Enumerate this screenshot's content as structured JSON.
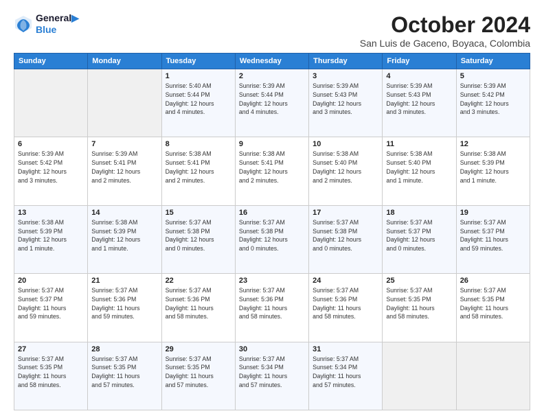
{
  "logo": {
    "line1": "General",
    "line2": "Blue"
  },
  "title": "October 2024",
  "location": "San Luis de Gaceno, Boyaca, Colombia",
  "days_of_week": [
    "Sunday",
    "Monday",
    "Tuesday",
    "Wednesday",
    "Thursday",
    "Friday",
    "Saturday"
  ],
  "weeks": [
    [
      {
        "day": "",
        "info": ""
      },
      {
        "day": "",
        "info": ""
      },
      {
        "day": "1",
        "info": "Sunrise: 5:40 AM\nSunset: 5:44 PM\nDaylight: 12 hours\nand 4 minutes."
      },
      {
        "day": "2",
        "info": "Sunrise: 5:39 AM\nSunset: 5:44 PM\nDaylight: 12 hours\nand 4 minutes."
      },
      {
        "day": "3",
        "info": "Sunrise: 5:39 AM\nSunset: 5:43 PM\nDaylight: 12 hours\nand 3 minutes."
      },
      {
        "day": "4",
        "info": "Sunrise: 5:39 AM\nSunset: 5:43 PM\nDaylight: 12 hours\nand 3 minutes."
      },
      {
        "day": "5",
        "info": "Sunrise: 5:39 AM\nSunset: 5:42 PM\nDaylight: 12 hours\nand 3 minutes."
      }
    ],
    [
      {
        "day": "6",
        "info": "Sunrise: 5:39 AM\nSunset: 5:42 PM\nDaylight: 12 hours\nand 3 minutes."
      },
      {
        "day": "7",
        "info": "Sunrise: 5:39 AM\nSunset: 5:41 PM\nDaylight: 12 hours\nand 2 minutes."
      },
      {
        "day": "8",
        "info": "Sunrise: 5:38 AM\nSunset: 5:41 PM\nDaylight: 12 hours\nand 2 minutes."
      },
      {
        "day": "9",
        "info": "Sunrise: 5:38 AM\nSunset: 5:41 PM\nDaylight: 12 hours\nand 2 minutes."
      },
      {
        "day": "10",
        "info": "Sunrise: 5:38 AM\nSunset: 5:40 PM\nDaylight: 12 hours\nand 2 minutes."
      },
      {
        "day": "11",
        "info": "Sunrise: 5:38 AM\nSunset: 5:40 PM\nDaylight: 12 hours\nand 1 minute."
      },
      {
        "day": "12",
        "info": "Sunrise: 5:38 AM\nSunset: 5:39 PM\nDaylight: 12 hours\nand 1 minute."
      }
    ],
    [
      {
        "day": "13",
        "info": "Sunrise: 5:38 AM\nSunset: 5:39 PM\nDaylight: 12 hours\nand 1 minute."
      },
      {
        "day": "14",
        "info": "Sunrise: 5:38 AM\nSunset: 5:39 PM\nDaylight: 12 hours\nand 1 minute."
      },
      {
        "day": "15",
        "info": "Sunrise: 5:37 AM\nSunset: 5:38 PM\nDaylight: 12 hours\nand 0 minutes."
      },
      {
        "day": "16",
        "info": "Sunrise: 5:37 AM\nSunset: 5:38 PM\nDaylight: 12 hours\nand 0 minutes."
      },
      {
        "day": "17",
        "info": "Sunrise: 5:37 AM\nSunset: 5:38 PM\nDaylight: 12 hours\nand 0 minutes."
      },
      {
        "day": "18",
        "info": "Sunrise: 5:37 AM\nSunset: 5:37 PM\nDaylight: 12 hours\nand 0 minutes."
      },
      {
        "day": "19",
        "info": "Sunrise: 5:37 AM\nSunset: 5:37 PM\nDaylight: 11 hours\nand 59 minutes."
      }
    ],
    [
      {
        "day": "20",
        "info": "Sunrise: 5:37 AM\nSunset: 5:37 PM\nDaylight: 11 hours\nand 59 minutes."
      },
      {
        "day": "21",
        "info": "Sunrise: 5:37 AM\nSunset: 5:36 PM\nDaylight: 11 hours\nand 59 minutes."
      },
      {
        "day": "22",
        "info": "Sunrise: 5:37 AM\nSunset: 5:36 PM\nDaylight: 11 hours\nand 58 minutes."
      },
      {
        "day": "23",
        "info": "Sunrise: 5:37 AM\nSunset: 5:36 PM\nDaylight: 11 hours\nand 58 minutes."
      },
      {
        "day": "24",
        "info": "Sunrise: 5:37 AM\nSunset: 5:36 PM\nDaylight: 11 hours\nand 58 minutes."
      },
      {
        "day": "25",
        "info": "Sunrise: 5:37 AM\nSunset: 5:35 PM\nDaylight: 11 hours\nand 58 minutes."
      },
      {
        "day": "26",
        "info": "Sunrise: 5:37 AM\nSunset: 5:35 PM\nDaylight: 11 hours\nand 58 minutes."
      }
    ],
    [
      {
        "day": "27",
        "info": "Sunrise: 5:37 AM\nSunset: 5:35 PM\nDaylight: 11 hours\nand 58 minutes."
      },
      {
        "day": "28",
        "info": "Sunrise: 5:37 AM\nSunset: 5:35 PM\nDaylight: 11 hours\nand 57 minutes."
      },
      {
        "day": "29",
        "info": "Sunrise: 5:37 AM\nSunset: 5:35 PM\nDaylight: 11 hours\nand 57 minutes."
      },
      {
        "day": "30",
        "info": "Sunrise: 5:37 AM\nSunset: 5:34 PM\nDaylight: 11 hours\nand 57 minutes."
      },
      {
        "day": "31",
        "info": "Sunrise: 5:37 AM\nSunset: 5:34 PM\nDaylight: 11 hours\nand 57 minutes."
      },
      {
        "day": "",
        "info": ""
      },
      {
        "day": "",
        "info": ""
      }
    ]
  ]
}
